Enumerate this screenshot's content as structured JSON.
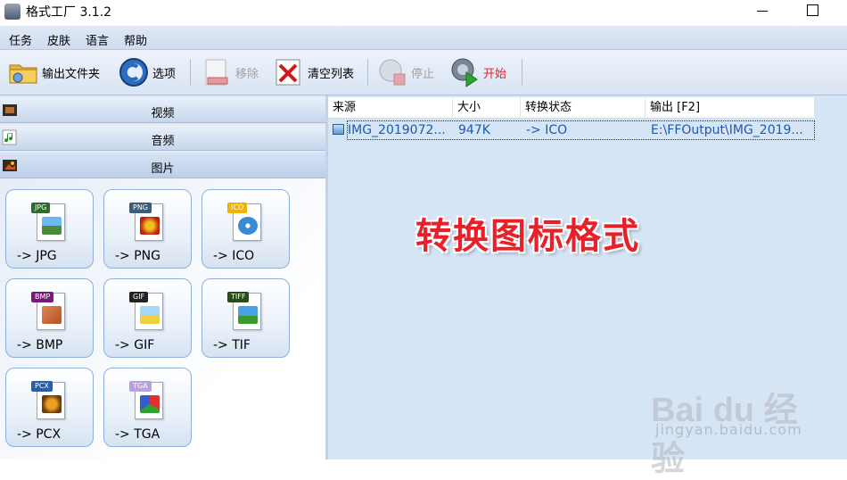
{
  "window": {
    "title": "格式工厂 3.1.2"
  },
  "menu": [
    "任务",
    "皮肤",
    "语言",
    "帮助"
  ],
  "toolbar": {
    "output_folder": "输出文件夹",
    "options": "选项",
    "remove": "移除",
    "clear_list": "清空列表",
    "stop": "停止",
    "start": "开始"
  },
  "categories": {
    "video": "视频",
    "audio": "音频",
    "image": "图片"
  },
  "formats": [
    {
      "tag": "JPG",
      "label": "-> JPG",
      "color": "#2e6a2e"
    },
    {
      "tag": "PNG",
      "label": "-> PNG",
      "color": "#3a5d7a"
    },
    {
      "tag": "ICO",
      "label": "-> ICO",
      "color": "#f0b400"
    },
    {
      "tag": "BMP",
      "label": "-> BMP",
      "color": "#7a1a7a"
    },
    {
      "tag": "GIF",
      "label": "-> GIF",
      "color": "#222222"
    },
    {
      "tag": "TIFF",
      "label": "-> TIF",
      "color": "#2b4a1a"
    },
    {
      "tag": "PCX",
      "label": "-> PCX",
      "color": "#2a5ea8"
    },
    {
      "tag": "TGA",
      "label": "-> TGA",
      "color": "#b8a0d8"
    }
  ],
  "table": {
    "headers": [
      "来源",
      "大小",
      "转换状态",
      "输出 [F2]"
    ],
    "rows": [
      {
        "source": "IMG_2019072...",
        "size": "947K",
        "status": "-> ICO",
        "output": "E:\\FFOutput\\IMG_2019..."
      }
    ]
  },
  "overlay_text": "转换图标格式",
  "watermark": {
    "brand": "Bai du 经验",
    "url": "jingyan.baidu.com"
  },
  "colors": {
    "accent_red": "#e8202a",
    "link_blue": "#1f5aa8"
  }
}
